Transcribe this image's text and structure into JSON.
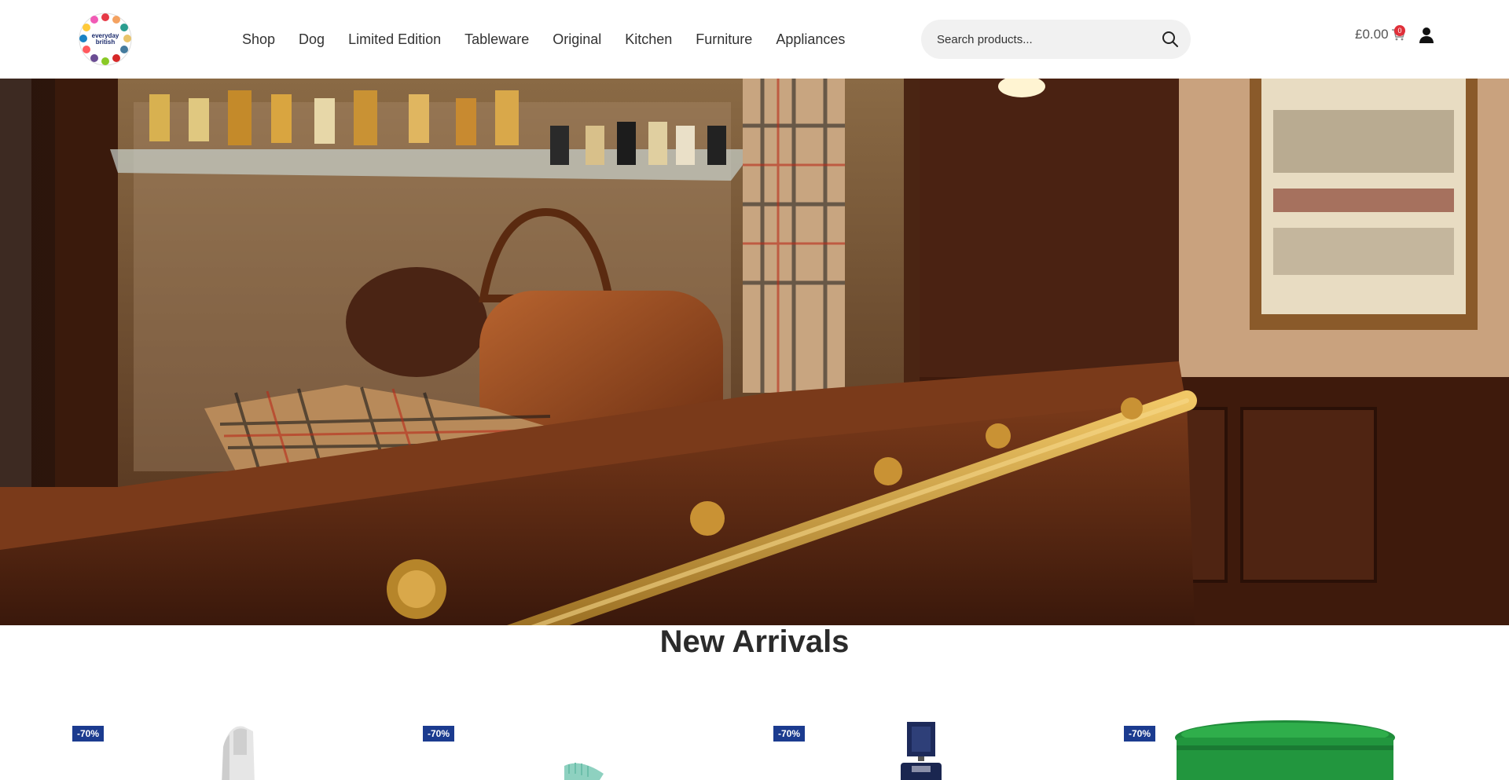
{
  "header": {
    "logo": {
      "line1": "everyday",
      "line2": "british"
    },
    "nav": [
      "Shop",
      "Dog",
      "Limited Edition",
      "Tableware",
      "Original",
      "Kitchen",
      "Furniture",
      "Appliances"
    ],
    "search": {
      "placeholder": "Search products..."
    },
    "cart": {
      "total": "£0.00",
      "count": "0"
    }
  },
  "hero": {
    "alt": "Shop interior with leather bags, tartan scarves and perfume bottles"
  },
  "new_arrivals": {
    "title": "New Arrivals",
    "products": [
      {
        "badge": "-70%",
        "icon": "spray-bottle-icon"
      },
      {
        "badge": "-70%",
        "icon": "brush-icon"
      },
      {
        "badge": "-70%",
        "icon": "perfume-bottle-icon"
      },
      {
        "badge": "-70%",
        "icon": "green-bucket-icon"
      }
    ]
  },
  "colors": {
    "accent_badge": "#1b3b8f",
    "cart_badge": "#e0303a",
    "search_bg": "#f1f1f1"
  }
}
